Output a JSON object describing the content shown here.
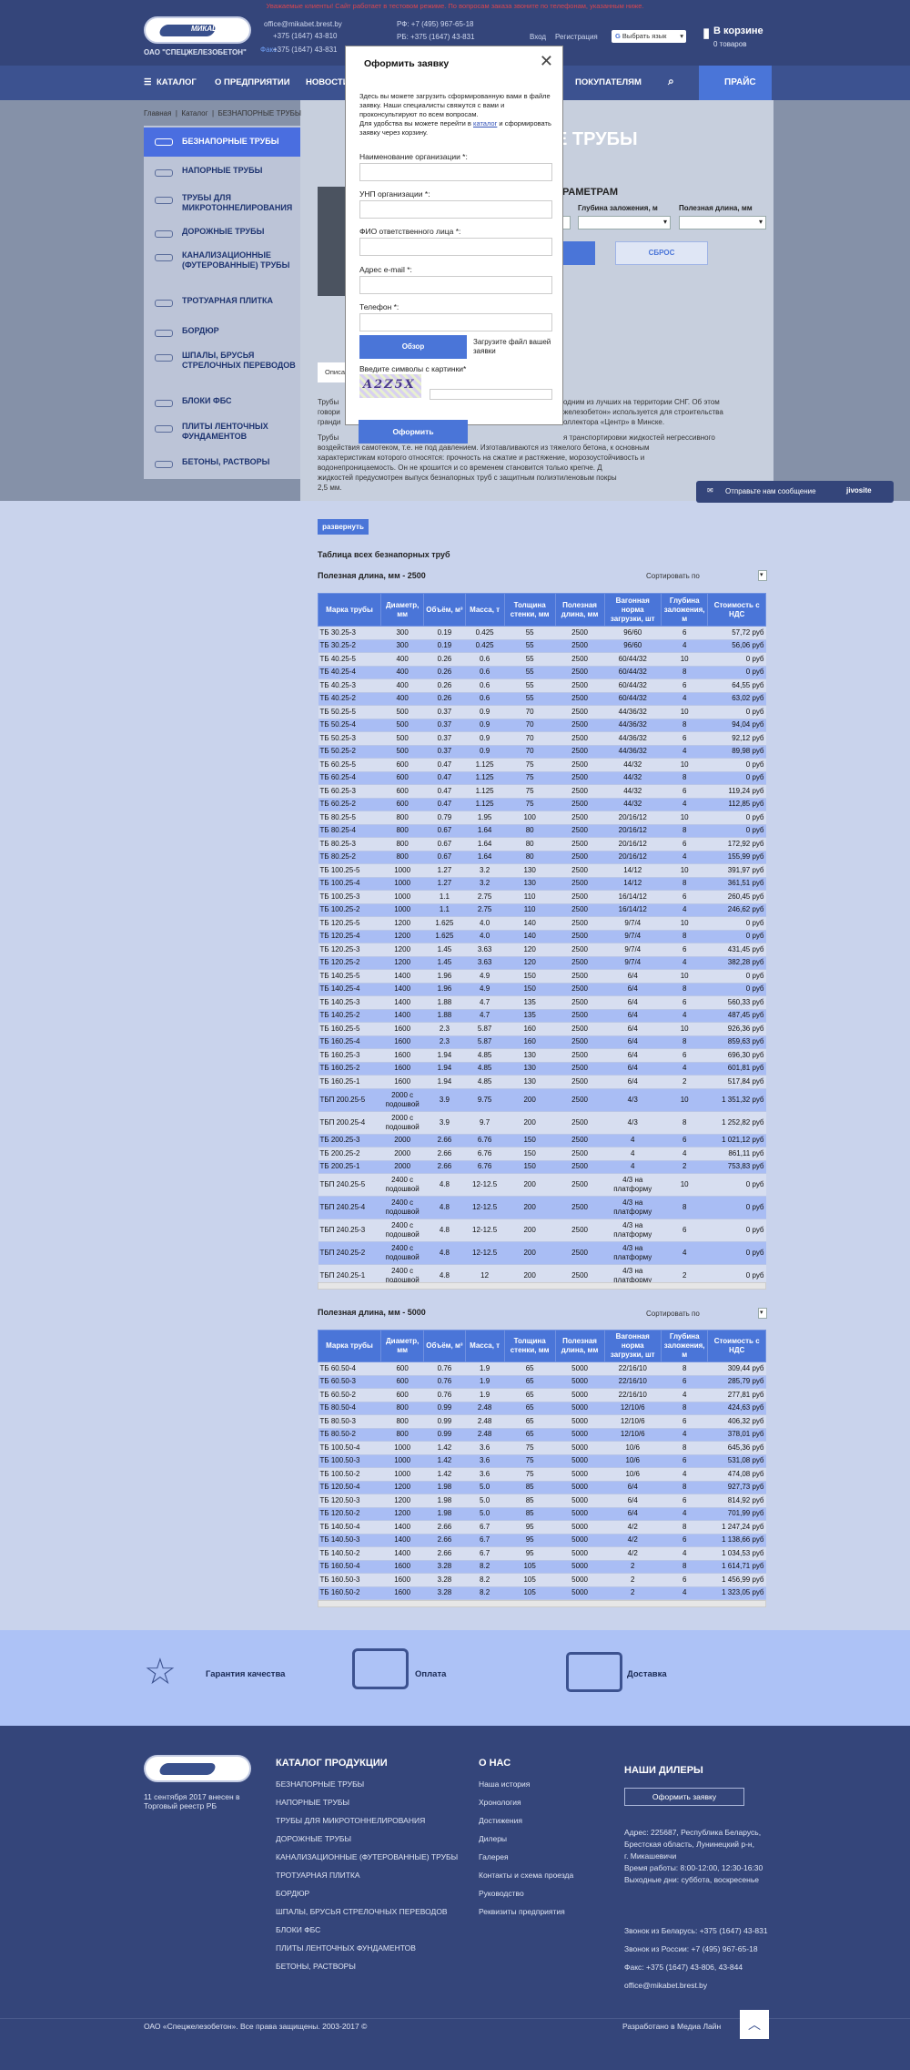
{
  "header": {
    "warning": "Уважаемые клиенты! Сайт работает в тестовом режиме. По вопросам заказа звоните по телефонам, указанным ниже.",
    "company": "ОАО \"СПЕЦЖЕЛЕЗОБЕТОН\"",
    "logo_text": "МИКАШ",
    "email": "office@mikabet.brest.by",
    "phone_by1": "+375 (1647) 43-810",
    "phone_by2": "+375 (1647) 43-831",
    "phone_ru": "РФ: +7 (495) 967-65-18",
    "phone_rb": "РБ: +375 (1647) 43-831",
    "fax_label": "Факс",
    "login": "Вход",
    "register": "Регистрация",
    "lang_select": "Выбрать язык",
    "cart_title": "В корзине",
    "cart_count": "0 товаров"
  },
  "nav": {
    "items": [
      "КАТАЛОГ",
      "О ПРЕДПРИЯТИИ",
      "НОВОСТИ",
      "ПОКУПАТЕЛЯМ"
    ],
    "price": "ПРАЙС"
  },
  "breadcrumb": [
    "Главная",
    "Каталог",
    "БЕЗНАПОРНЫЕ ТРУБЫ"
  ],
  "sidebar": [
    "БЕЗНАПОРНЫЕ ТРУБЫ",
    "НАПОРНЫЕ ТРУБЫ",
    "ТРУБЫ ДЛЯ МИКРОТОННЕЛИРОВАНИЯ",
    "ДОРОЖНЫЕ ТРУБЫ",
    "КАНАЛИЗАЦИОННЫЕ (ФУТЕРОВАННЫЕ) ТРУБЫ",
    "ТРОТУАРНАЯ ПЛИТКА",
    "БОРДЮР",
    "ШПАЛЫ, БРУСЬЯ СТРЕЛОЧНЫХ ПЕРЕВОДОВ",
    "БЛОКИ ФБС",
    "ПЛИТЫ ЛЕНТОЧНЫХ ФУНДАМЕНТОВ",
    "БЕТОНЫ, РАСТВОРЫ"
  ],
  "page": {
    "title": "Е ТРУБЫ",
    "filter_title": "РАМЕТРАМ",
    "filter_depth": "Глубина заложения, м",
    "filter_length": "Полезная длина, мм",
    "reset": "СБРОС",
    "tab": "Описа",
    "desc1a": "Трубы",
    "desc1b": "одним из лучших на территории СНГ. Об этом",
    "desc2a": "говори",
    "desc2b": "железобетон» используется для строительства",
    "desc3a": "гранди",
    "desc3b": "оллектора «Центр» в Минске.",
    "desc4a": "Трубы",
    "desc4b": "я транспортировки жидкостей негрессивного",
    "desc5": "воздействия самотеком, т.е. не под давлением. Изготавливаются из тяжелого бетона, к основным",
    "desc6": "характеристикам которого относятся: прочность на сжатие и растяжение, морозоустойчивость и",
    "desc7": "водонепроницаемость. Он не крошится и со временем становится только крепче. Д",
    "desc8": "жидкостей предусмотрен выпуск безнапорных труб с защитным полиэтиленовым покры",
    "desc9": "2,5 мм.",
    "expand": "развернуть",
    "table_heading": "Таблица всех безнапорных труб",
    "sort_label": "Сортировать по"
  },
  "modal": {
    "title": "Оформить заявку",
    "close": "✕",
    "intro1": "Здесь вы можете загрузить сформированную вами в файле заявку. Наши специалисты свяжутся с вами и проконсультируют по всем вопросам.",
    "intro2a": "Для удобства вы можете перейти в ",
    "intro2_link": "каталог",
    "intro2b": " и сформировать заявку через корзину.",
    "f_org": "Наименование организации *:",
    "f_unp": "УНП организации *:",
    "f_fio": "ФИО ответственного лица *:",
    "f_email": "Адрес e-mail *:",
    "f_phone": "Телефон *:",
    "browse": "Обзор",
    "upload_hint": "Загрузите файл вашей заявки",
    "captcha_label": "Введите символы с картинки*",
    "captcha_text": "A2Z5X",
    "submit": "Оформить"
  },
  "chat": {
    "label": "Отправьте нам сообщение",
    "brand": "jivosite"
  },
  "columns": [
    "Марка трубы",
    "Диаметр, мм",
    "Объём, м³",
    "Масса, т",
    "Толщина стенки, мм",
    "Полезная длина, мм",
    "Вагонная норма загрузки, шт",
    "Глубина заложения, м",
    "Стоимость с НДС"
  ],
  "table1": {
    "title": "Полезная длина, мм - 2500",
    "rows": [
      [
        "ТБ 30.25-3",
        "300",
        "0.19",
        "0.425",
        "55",
        "2500",
        "96/60",
        "6",
        "57,72 руб"
      ],
      [
        "ТБ 30.25-2",
        "300",
        "0.19",
        "0.425",
        "55",
        "2500",
        "96/60",
        "4",
        "56,06 руб"
      ],
      [
        "ТБ 40.25-5",
        "400",
        "0.26",
        "0.6",
        "55",
        "2500",
        "60/44/32",
        "10",
        "0 руб"
      ],
      [
        "ТБ 40.25-4",
        "400",
        "0.26",
        "0.6",
        "55",
        "2500",
        "60/44/32",
        "8",
        "0 руб"
      ],
      [
        "ТБ 40.25-3",
        "400",
        "0.26",
        "0.6",
        "55",
        "2500",
        "60/44/32",
        "6",
        "64,55 руб"
      ],
      [
        "ТБ 40.25-2",
        "400",
        "0.26",
        "0.6",
        "55",
        "2500",
        "60/44/32",
        "4",
        "63,02 руб"
      ],
      [
        "ТБ 50.25-5",
        "500",
        "0.37",
        "0.9",
        "70",
        "2500",
        "44/36/32",
        "10",
        "0 руб"
      ],
      [
        "ТБ 50.25-4",
        "500",
        "0.37",
        "0.9",
        "70",
        "2500",
        "44/36/32",
        "8",
        "94,04 руб"
      ],
      [
        "ТБ 50.25-3",
        "500",
        "0.37",
        "0.9",
        "70",
        "2500",
        "44/36/32",
        "6",
        "92,12 руб"
      ],
      [
        "ТБ 50.25-2",
        "500",
        "0.37",
        "0.9",
        "70",
        "2500",
        "44/36/32",
        "4",
        "89,98 руб"
      ],
      [
        "ТБ 60.25-5",
        "600",
        "0.47",
        "1.125",
        "75",
        "2500",
        "44/32",
        "10",
        "0 руб"
      ],
      [
        "ТБ 60.25-4",
        "600",
        "0.47",
        "1.125",
        "75",
        "2500",
        "44/32",
        "8",
        "0 руб"
      ],
      [
        "ТБ 60.25-3",
        "600",
        "0.47",
        "1.125",
        "75",
        "2500",
        "44/32",
        "6",
        "119,24 руб"
      ],
      [
        "ТБ 60.25-2",
        "600",
        "0.47",
        "1.125",
        "75",
        "2500",
        "44/32",
        "4",
        "112,85 руб"
      ],
      [
        "ТБ 80.25-5",
        "800",
        "0.79",
        "1.95",
        "100",
        "2500",
        "20/16/12",
        "10",
        "0 руб"
      ],
      [
        "ТБ 80.25-4",
        "800",
        "0.67",
        "1.64",
        "80",
        "2500",
        "20/16/12",
        "8",
        "0 руб"
      ],
      [
        "ТБ 80.25-3",
        "800",
        "0.67",
        "1.64",
        "80",
        "2500",
        "20/16/12",
        "6",
        "172,92 руб"
      ],
      [
        "ТБ 80.25-2",
        "800",
        "0.67",
        "1.64",
        "80",
        "2500",
        "20/16/12",
        "4",
        "155,99 руб"
      ],
      [
        "ТБ 100.25-5",
        "1000",
        "1.27",
        "3.2",
        "130",
        "2500",
        "14/12",
        "10",
        "391,97 руб"
      ],
      [
        "ТБ 100.25-4",
        "1000",
        "1.27",
        "3.2",
        "130",
        "2500",
        "14/12",
        "8",
        "361,51 руб"
      ],
      [
        "ТБ 100.25-3",
        "1000",
        "1.1",
        "2.75",
        "110",
        "2500",
        "16/14/12",
        "6",
        "260,45 руб"
      ],
      [
        "ТБ 100.25-2",
        "1000",
        "1.1",
        "2.75",
        "110",
        "2500",
        "16/14/12",
        "4",
        "246,62 руб"
      ],
      [
        "ТБ 120.25-5",
        "1200",
        "1.625",
        "4.0",
        "140",
        "2500",
        "9/7/4",
        "10",
        "0 руб"
      ],
      [
        "ТБ 120.25-4",
        "1200",
        "1.625",
        "4.0",
        "140",
        "2500",
        "9/7/4",
        "8",
        "0 руб"
      ],
      [
        "ТБ 120.25-3",
        "1200",
        "1.45",
        "3.63",
        "120",
        "2500",
        "9/7/4",
        "6",
        "431,45 руб"
      ],
      [
        "ТБ 120.25-2",
        "1200",
        "1.45",
        "3.63",
        "120",
        "2500",
        "9/7/4",
        "4",
        "382,28 руб"
      ],
      [
        "ТБ 140.25-5",
        "1400",
        "1.96",
        "4.9",
        "150",
        "2500",
        "6/4",
        "10",
        "0 руб"
      ],
      [
        "ТБ 140.25-4",
        "1400",
        "1.96",
        "4.9",
        "150",
        "2500",
        "6/4",
        "8",
        "0 руб"
      ],
      [
        "ТБ 140.25-3",
        "1400",
        "1.88",
        "4.7",
        "135",
        "2500",
        "6/4",
        "6",
        "560,33 руб"
      ],
      [
        "ТБ 140.25-2",
        "1400",
        "1.88",
        "4.7",
        "135",
        "2500",
        "6/4",
        "4",
        "487,45 руб"
      ],
      [
        "ТБ 160.25-5",
        "1600",
        "2.3",
        "5.87",
        "160",
        "2500",
        "6/4",
        "10",
        "926,36 руб"
      ],
      [
        "ТБ 160.25-4",
        "1600",
        "2.3",
        "5.87",
        "160",
        "2500",
        "6/4",
        "8",
        "859,63 руб"
      ],
      [
        "ТБ 160.25-3",
        "1600",
        "1.94",
        "4.85",
        "130",
        "2500",
        "6/4",
        "6",
        "696,30 руб"
      ],
      [
        "ТБ 160.25-2",
        "1600",
        "1.94",
        "4.85",
        "130",
        "2500",
        "6/4",
        "4",
        "601,81 руб"
      ],
      [
        "ТБ 160.25-1",
        "1600",
        "1.94",
        "4.85",
        "130",
        "2500",
        "6/4",
        "2",
        "517,84 руб"
      ],
      [
        "ТБП 200.25-5",
        "2000 с подошвой",
        "3.9",
        "9.75",
        "200",
        "2500",
        "4/3",
        "10",
        "1 351,32 руб"
      ],
      [
        "ТБП 200.25-4",
        "2000 с подошвой",
        "3.9",
        "9.7",
        "200",
        "2500",
        "4/3",
        "8",
        "1 252,82 руб"
      ],
      [
        "ТБ 200.25-3",
        "2000",
        "2.66",
        "6.76",
        "150",
        "2500",
        "4",
        "6",
        "1 021,12 руб"
      ],
      [
        "ТБ 200.25-2",
        "2000",
        "2.66",
        "6.76",
        "150",
        "2500",
        "4",
        "4",
        "861,11 руб"
      ],
      [
        "ТБ 200.25-1",
        "2000",
        "2.66",
        "6.76",
        "150",
        "2500",
        "4",
        "2",
        "753,83 руб"
      ],
      [
        "ТБП 240.25-5",
        "2400 с подошвой",
        "4.8",
        "12-12.5",
        "200",
        "2500",
        "4/3 на платформу",
        "10",
        "0 руб"
      ],
      [
        "ТБП 240.25-4",
        "2400 с подошвой",
        "4.8",
        "12-12.5",
        "200",
        "2500",
        "4/3 на платформу",
        "8",
        "0 руб"
      ],
      [
        "ТБП 240.25-3",
        "2400 с подошвой",
        "4.8",
        "12-12.5",
        "200",
        "2500",
        "4/3 на платформу",
        "6",
        "0 руб"
      ],
      [
        "ТБП 240.25-2",
        "2400 с подошвой",
        "4.8",
        "12-12.5",
        "200",
        "2500",
        "4/3 на платформу",
        "4",
        "0 руб"
      ],
      [
        "ТБП 240.25-1",
        "2400 с подошвой",
        "4.8",
        "12",
        "200",
        "2500",
        "4/3 на платформу",
        "2",
        "0 руб"
      ]
    ]
  },
  "table2": {
    "title": "Полезная длина, мм - 5000",
    "rows": [
      [
        "ТБ 60.50-4",
        "600",
        "0.76",
        "1.9",
        "65",
        "5000",
        "22/16/10",
        "8",
        "309,44 руб"
      ],
      [
        "ТБ 60.50-3",
        "600",
        "0.76",
        "1.9",
        "65",
        "5000",
        "22/16/10",
        "6",
        "285,79 руб"
      ],
      [
        "ТБ 60.50-2",
        "600",
        "0.76",
        "1.9",
        "65",
        "5000",
        "22/16/10",
        "4",
        "277,81 руб"
      ],
      [
        "ТБ 80.50-4",
        "800",
        "0.99",
        "2.48",
        "65",
        "5000",
        "12/10/6",
        "8",
        "424,63 руб"
      ],
      [
        "ТБ 80.50-3",
        "800",
        "0.99",
        "2.48",
        "65",
        "5000",
        "12/10/6",
        "6",
        "406,32 руб"
      ],
      [
        "ТБ 80.50-2",
        "800",
        "0.99",
        "2.48",
        "65",
        "5000",
        "12/10/6",
        "4",
        "378,01 руб"
      ],
      [
        "ТБ 100.50-4",
        "1000",
        "1.42",
        "3.6",
        "75",
        "5000",
        "10/6",
        "8",
        "645,36 руб"
      ],
      [
        "ТБ 100.50-3",
        "1000",
        "1.42",
        "3.6",
        "75",
        "5000",
        "10/6",
        "6",
        "531,08 руб"
      ],
      [
        "ТБ 100.50-2",
        "1000",
        "1.42",
        "3.6",
        "75",
        "5000",
        "10/6",
        "4",
        "474,08 руб"
      ],
      [
        "ТБ 120.50-4",
        "1200",
        "1.98",
        "5.0",
        "85",
        "5000",
        "6/4",
        "8",
        "927,73 руб"
      ],
      [
        "ТБ 120.50-3",
        "1200",
        "1.98",
        "5.0",
        "85",
        "5000",
        "6/4",
        "6",
        "814,92 руб"
      ],
      [
        "ТБ 120.50-2",
        "1200",
        "1.98",
        "5.0",
        "85",
        "5000",
        "6/4",
        "4",
        "701,99 руб"
      ],
      [
        "ТБ 140.50-4",
        "1400",
        "2.66",
        "6.7",
        "95",
        "5000",
        "4/2",
        "8",
        "1 247,24 руб"
      ],
      [
        "ТБ 140.50-3",
        "1400",
        "2.66",
        "6.7",
        "95",
        "5000",
        "4/2",
        "6",
        "1 138,66 руб"
      ],
      [
        "ТБ 140.50-2",
        "1400",
        "2.66",
        "6.7",
        "95",
        "5000",
        "4/2",
        "4",
        "1 034,53 руб"
      ],
      [
        "ТБ 160.50-4",
        "1600",
        "3.28",
        "8.2",
        "105",
        "5000",
        "2",
        "8",
        "1 614,71 руб"
      ],
      [
        "ТБ 160.50-3",
        "1600",
        "3.28",
        "8.2",
        "105",
        "5000",
        "2",
        "6",
        "1 456,99 руб"
      ],
      [
        "ТБ 160.50-2",
        "1600",
        "3.28",
        "8.2",
        "105",
        "5000",
        "2",
        "4",
        "1 323,05 руб"
      ]
    ]
  },
  "features": [
    "Гарантия качества",
    "Оплата",
    "Доставка"
  ],
  "footer": {
    "reg_note": "11 сентября 2017 внесен в Торговый реестр РБ",
    "catalog_title": "КАТАЛОГ ПРОДУКЦИИ",
    "catalog": [
      "БЕЗНАПОРНЫЕ ТРУБЫ",
      "НАПОРНЫЕ ТРУБЫ",
      "ТРУБЫ ДЛЯ МИКРОТОННЕЛИРОВАНИЯ",
      "ДОРОЖНЫЕ ТРУБЫ",
      "КАНАЛИЗАЦИОННЫЕ (ФУТЕРОВАННЫЕ) ТРУБЫ",
      "ТРОТУАРНАЯ ПЛИТКА",
      "БОРДЮР",
      "ШПАЛЫ, БРУСЬЯ СТРЕЛОЧНЫХ ПЕРЕВОДОВ",
      "БЛОКИ ФБС",
      "ПЛИТЫ ЛЕНТОЧНЫХ ФУНДАМЕНТОВ",
      "БЕТОНЫ, РАСТВОРЫ"
    ],
    "about_title": "О НАС",
    "about": [
      "Наша история",
      "Хронология",
      "Достижения",
      "Дилеры",
      "Галерея",
      "Контакты и схема проезда",
      "Руководство",
      "Реквизиты предприятия"
    ],
    "dealers_title": "НАШИ ДИЛЕРЫ",
    "order_btn": "Оформить заявку",
    "address": [
      "Адрес: 225687, Республика Беларусь,",
      "Брестская область, Лунинецкий р-н,",
      "г. Микашевичи",
      "Время работы: 8:00-12:00, 12:30-16:30",
      "Выходные дни: суббота, воскресенье"
    ],
    "phones": [
      "Звонок из Беларусь: +375 (1647) 43-831",
      "Звонок из России: +7 (495) 967-65-18",
      "Факс: +375 (1647) 43-806, 43-844",
      "office@mikabet.brest.by"
    ],
    "copyright": "ОАО «Спецжелезобетон». Все права защищены. 2003-2017 ©",
    "dev": "Разработано в Медиа Лайн",
    "up": "︿"
  }
}
